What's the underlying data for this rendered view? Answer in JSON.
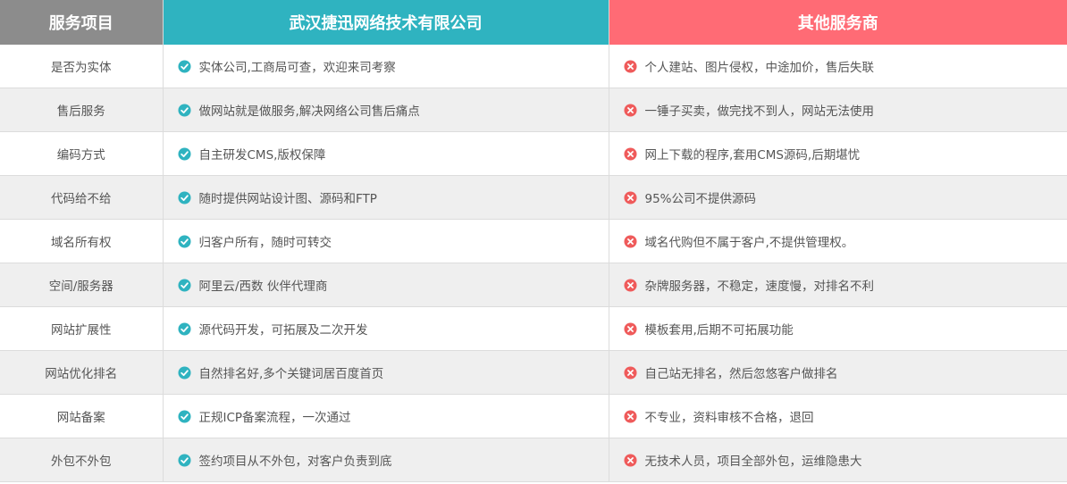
{
  "header": {
    "col_item": "服务项目",
    "col_ours": "武汉捷迅网络技术有限公司",
    "col_others": "其他服务商"
  },
  "colors": {
    "ours_accent": "#2fb3c0",
    "others_accent": "#ff6b75",
    "item_header": "#8c8c8c",
    "check_icon": "#2fb3c0",
    "cross_icon": "#ef5b5b"
  },
  "rows": [
    {
      "item": "是否为实体",
      "ours": "实体公司,工商局可查，欢迎来司考察",
      "others": "个人建站、图片侵权，中途加价，售后失联"
    },
    {
      "item": "售后服务",
      "ours": "做网站就是做服务,解决网络公司售后痛点",
      "others": "一锤子买卖，做完找不到人，网站无法使用"
    },
    {
      "item": "编码方式",
      "ours": "自主研发CMS,版权保障",
      "others": "网上下载的程序,套用CMS源码,后期堪忧"
    },
    {
      "item": "代码给不给",
      "ours": "随时提供网站设计图、源码和FTP",
      "others": "95%公司不提供源码"
    },
    {
      "item": "域名所有权",
      "ours": "归客户所有，随时可转交",
      "others": "域名代购但不属于客户,不提供管理权。"
    },
    {
      "item": "空间/服务器",
      "ours": "阿里云/西数 伙伴代理商",
      "others": "杂牌服务器，不稳定，速度慢，对排名不利"
    },
    {
      "item": "网站扩展性",
      "ours": "源代码开发，可拓展及二次开发",
      "others": "模板套用,后期不可拓展功能"
    },
    {
      "item": "网站优化排名",
      "ours": "自然排名好,多个关键词居百度首页",
      "others": "自己站无排名，然后忽悠客户做排名"
    },
    {
      "item": "网站备案",
      "ours": "正规ICP备案流程，一次通过",
      "others": "不专业，资料审核不合格，退回"
    },
    {
      "item": "外包不外包",
      "ours": "签约项目从不外包，对客户负责到底",
      "others": "无技术人员，项目全部外包，运维隐患大"
    }
  ]
}
